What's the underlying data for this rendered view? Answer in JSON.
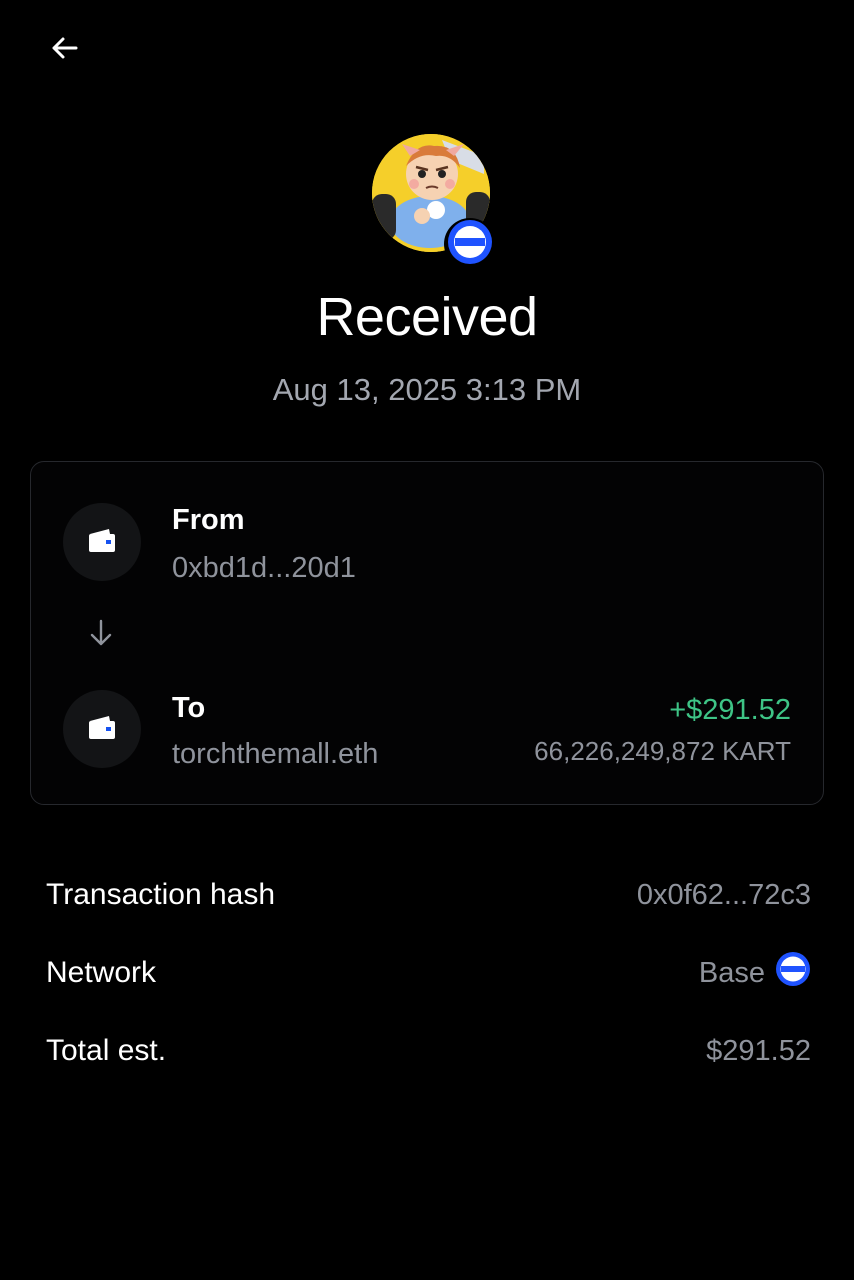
{
  "header": {
    "back_icon": "arrow-left-icon"
  },
  "token": {
    "avatar": "token-avatar-kart",
    "network_badge_icon": "base-network-icon"
  },
  "status": {
    "title": "Received",
    "datetime": "Aug 13, 2025 3:13 PM"
  },
  "transfer": {
    "from": {
      "label": "From",
      "address": "0xbd1d...20d1",
      "icon": "wallet-icon"
    },
    "arrow_icon": "arrow-down-icon",
    "to": {
      "label": "To",
      "address": "torchthemall.eth",
      "icon": "wallet-icon",
      "amount_usd": "+$291.52",
      "amount_token": "66,226,249,872 KART"
    }
  },
  "details": {
    "hash_label": "Transaction hash",
    "hash_value": "0x0f62...72c3",
    "network_label": "Network",
    "network_value": "Base",
    "network_icon": "base-network-icon",
    "total_label": "Total est.",
    "total_value": "$291.52"
  },
  "colors": {
    "background": "#000000",
    "positive": "#3ec486",
    "muted_text": "#8f939c",
    "base_blue": "#0052ff"
  }
}
